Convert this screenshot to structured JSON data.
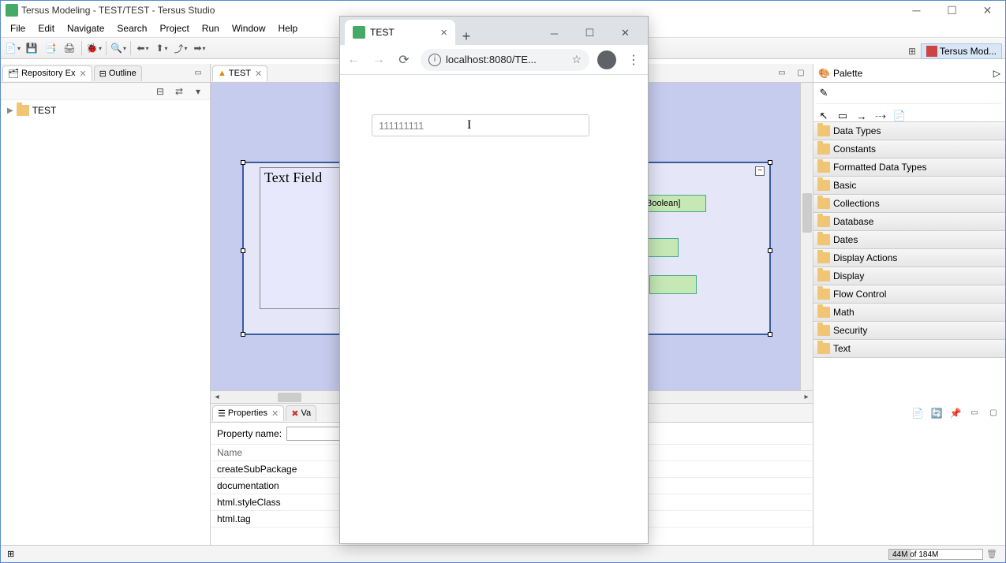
{
  "ide": {
    "title": "Tersus Modeling - TEST/TEST - Tersus Studio",
    "menu": [
      "File",
      "Edit",
      "Navigate",
      "Search",
      "Project",
      "Run",
      "Window",
      "Help"
    ],
    "perspective": "Tersus Mod...",
    "leftPanel": {
      "tabs": [
        {
          "label": "Repository Ex",
          "active": true
        },
        {
          "label": "Outline",
          "active": false
        }
      ],
      "tree": [
        {
          "label": "TEST"
        }
      ]
    },
    "editor": {
      "tab": "TEST",
      "textFieldLabel": "Text Field",
      "booleanLabel": "Boolean]"
    },
    "bottomPanel": {
      "tabs": [
        {
          "label": "Properties",
          "active": true
        },
        {
          "label": "Va",
          "active": false
        }
      ],
      "filterLabel": "Property name:",
      "headerName": "Name",
      "rows": [
        "createSubPackage",
        "documentation",
        "html.styleClass",
        "html.tag"
      ]
    },
    "palette": {
      "title": "Palette",
      "categories": [
        "Data Types",
        "Constants",
        "Formatted Data Types",
        "Basic",
        "Collections",
        "Database",
        "Dates",
        "Display Actions",
        "Display",
        "Flow Control",
        "Math",
        "Security",
        "Text"
      ]
    },
    "status": {
      "heap": "44M of 184M"
    }
  },
  "browser": {
    "tabTitle": "TEST",
    "url": "localhost:8080/TE...",
    "inputValue": "111111111"
  }
}
